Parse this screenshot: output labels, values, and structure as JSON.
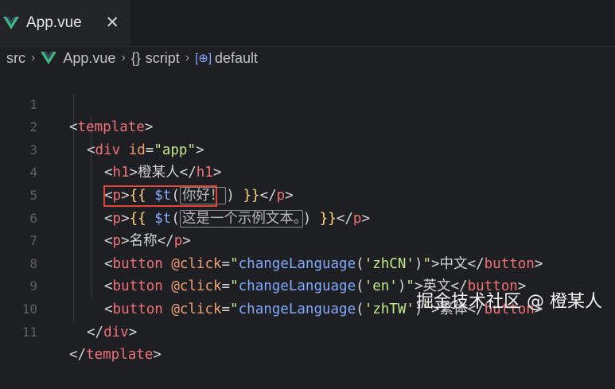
{
  "tab": {
    "label": "App.vue",
    "close": "✕"
  },
  "breadcrumb": {
    "folder": "src",
    "file": "App.vue",
    "section": "script",
    "symbol": "default",
    "section_icon": "{}",
    "symbol_icon": "[⊕]"
  },
  "code": {
    "line_numbers": [
      "1",
      "2",
      "3",
      "4",
      "5",
      "6",
      "7",
      "8",
      "9",
      "10",
      "11"
    ],
    "hint_hello": "你好！",
    "hint_sample": "这是一个示例文本。",
    "h1_text": "橙某人",
    "name_text": "名称",
    "btn_cn": "中文",
    "btn_en": "英文",
    "btn_tw": "繁体"
  },
  "watermark": "掘金技术社区 @ 橙某人",
  "colors": {
    "highlight_box": "#e0463a",
    "vue_green": "#41b883"
  }
}
